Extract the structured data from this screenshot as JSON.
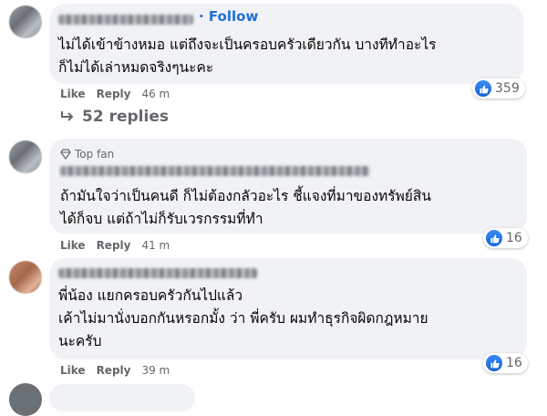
{
  "comments": [
    {
      "follow_label": "Follow",
      "lines": [
        "ไม่ได้เข้าข้างหมอ แต่ถึงจะเป็นครอบครัวเดียวกัน บางทีทำอะไร",
        "ก็ไม่ได้เล่าหมดจริงๆนะคะ"
      ],
      "like_label": "Like",
      "reply_label": "Reply",
      "time": "46 m",
      "reaction_count": "359",
      "replies_label": "52 replies"
    },
    {
      "badge": "Top fan",
      "lines": [
        "ถ้ามันใจว่าเป็นคนดี ก็ไม่ต้องกลัวอะไร ชี้แจงที่มาของทรัพย์สิน",
        "ได้ก็จบ แต่ถ้าไม่ก็รับเวรกรรมที่ทำ"
      ],
      "like_label": "Like",
      "reply_label": "Reply",
      "time": "41 m",
      "reaction_count": "16"
    },
    {
      "lines": [
        "พี่น้อง แยกครอบครัวกันไปแล้ว",
        "เค้าไม่มานั่งบอกกันหรอกมั้ง ว่า พี่ครับ ผมทำธุรกิจผิดกฎหมาย",
        "นะครับ"
      ],
      "like_label": "Like",
      "reply_label": "Reply",
      "time": "39 m",
      "reaction_count": "16"
    }
  ],
  "colors": {
    "bubble": "#f0f2f5",
    "follow": "#216fdb",
    "meta": "#65676b",
    "like_blue": "#1877f2"
  },
  "icons": {
    "like": "thumbs-up-icon",
    "reply_arrow": "reply-arrow-icon",
    "top_fan": "diamond-icon"
  }
}
